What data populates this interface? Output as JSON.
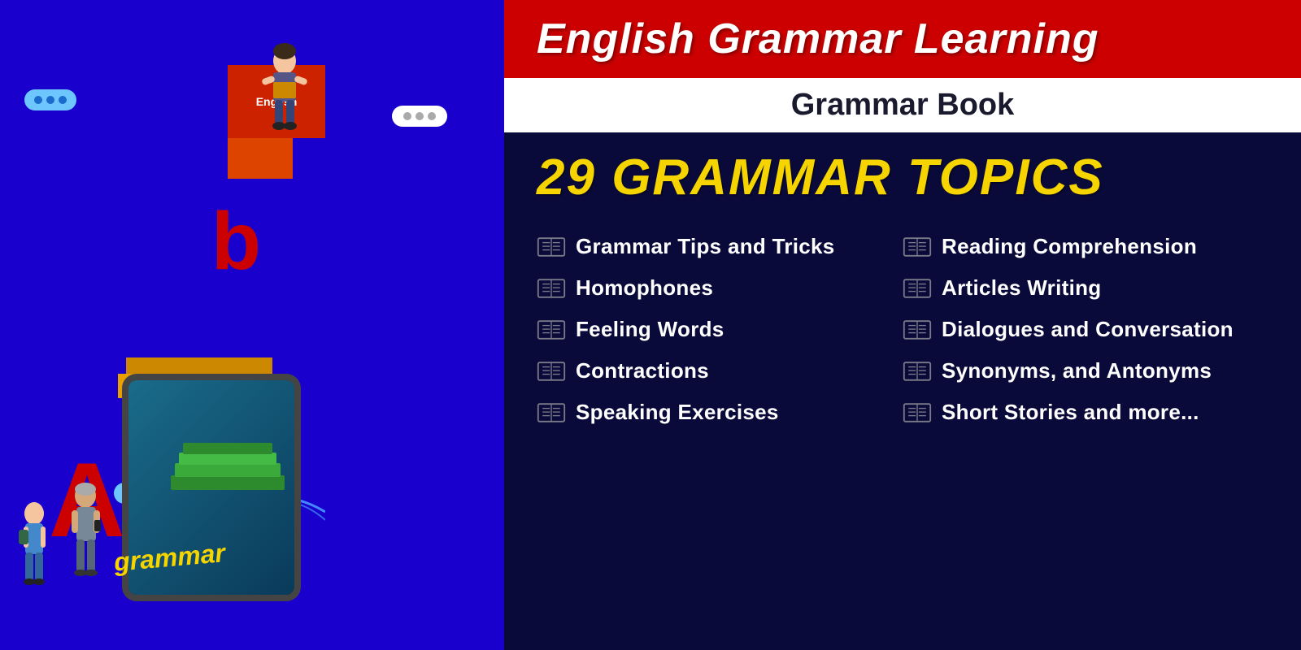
{
  "left_panel": {
    "background_color": "#1a00cc",
    "letter_a": "A",
    "letter_b": "b",
    "grammar_word": "grammar",
    "english_label": "English"
  },
  "right_panel": {
    "title_bar": {
      "text": "English Grammar Learning",
      "background": "#cc0000"
    },
    "subtitle_bar": {
      "text": "Grammar Book",
      "background": "#ffffff"
    },
    "topics_heading": "29 GRAMMAR TOPICS",
    "topics_left": [
      "Grammar Tips and Tricks",
      "Homophones",
      "Feeling Words",
      "Contractions",
      "Speaking Exercises"
    ],
    "topics_right": [
      "Reading Comprehension",
      "Articles Writing",
      "Dialogues and Conversation",
      "Synonyms, and Antonyms",
      "Short Stories and more..."
    ]
  }
}
